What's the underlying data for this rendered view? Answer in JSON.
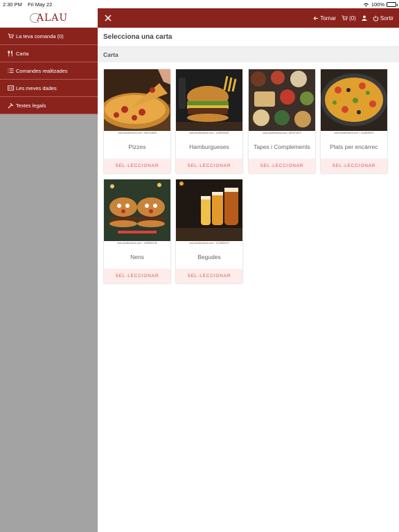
{
  "status_bar": {
    "time": "2:30 PM",
    "date": "Fri May 22",
    "battery": "100%",
    "battery_level": 1.0
  },
  "sidebar": {
    "logo_text": "ALAU",
    "items": [
      {
        "label": "La teva comanda (0)",
        "icon": "cart-icon"
      },
      {
        "label": "Carta",
        "icon": "cutlery-icon"
      },
      {
        "label": "Comandes realitzades",
        "icon": "list-icon"
      },
      {
        "label": "Les meves dades",
        "icon": "id-card-icon"
      },
      {
        "label": "Textes legals",
        "icon": "gavel-icon"
      }
    ]
  },
  "header": {
    "back_label": "Tornar",
    "cart_count": "(0)",
    "logout_label": "Sortir"
  },
  "main": {
    "title": "Selecciona una carta",
    "section": "Carta",
    "select_label": "SEL·LECCIONAR",
    "cards": [
      {
        "name": "Pizzes",
        "credit": "www.shutterstock.com • 562124826"
      },
      {
        "name": "Hamburgueses",
        "credit": "www.shutterstock.com • 1248299461"
      },
      {
        "name": "Tapes i Complements",
        "credit": "www.shutterstock.com • 662974573"
      },
      {
        "name": "Plats per encàrrec",
        "credit": "www.shutterstock.com • 1149830672"
      },
      {
        "name": "Nens",
        "credit": "www.shutterstock.com • 1265551136"
      },
      {
        "name": "Begudes",
        "credit": "www.shutterstock.com • 1212869272"
      }
    ]
  },
  "colors": {
    "brand": "#8b231d",
    "select_bg": "#fdecea",
    "select_text": "#d9534f",
    "sidebar_bg": "#a3a3a3"
  }
}
